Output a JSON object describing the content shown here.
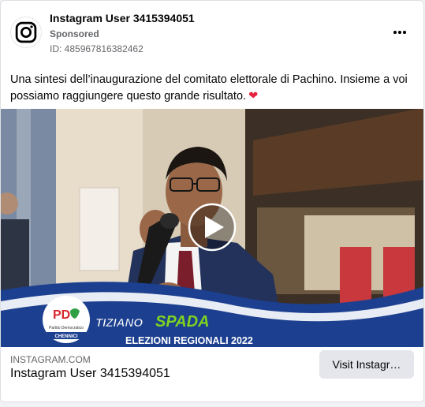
{
  "post": {
    "author": "Instagram User 3415394051",
    "sponsored_label": "Sponsored",
    "ad_id": "ID: 485967816382462",
    "text": "Una sintesi dell’inaugurazione del comitato elettorale di Pachino. Insieme a voi possiamo raggiungere questo grande risultato.",
    "text_emoji": "❤"
  },
  "media": {
    "party_logo_text": "PD",
    "party_name": "Partito Democratico",
    "candidate_first": "TIZIANO",
    "candidate_last": "SPADA",
    "banner": "ELEZIONI REGIONALI 2022",
    "sublabel": "CHENNICI",
    "play_icon": "play-icon"
  },
  "footer": {
    "domain": "INSTAGRAM.COM",
    "title": "Instagram User 3415394051",
    "cta_label": "Visit Instagr…"
  },
  "colors": {
    "accent_red": "#e5253c",
    "banner_blue": "#1c3f8f",
    "name_green": "#7ed321"
  }
}
